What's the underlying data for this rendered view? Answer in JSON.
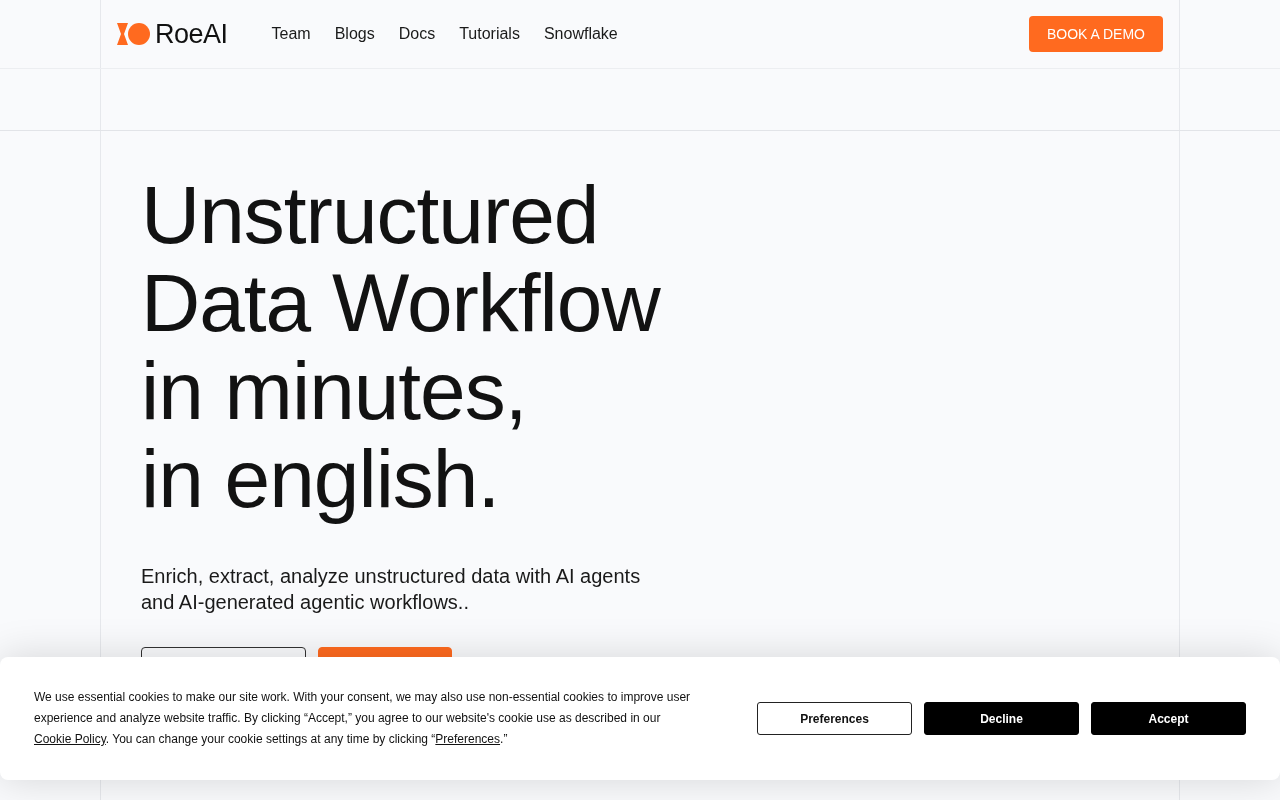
{
  "nav": {
    "logo": "RoeAI",
    "links": [
      {
        "label": "Team"
      },
      {
        "label": "Blogs"
      },
      {
        "label": "Docs"
      },
      {
        "label": "Tutorials"
      },
      {
        "label": "Snowflake"
      }
    ],
    "cta": "BOOK A DEMO"
  },
  "hero": {
    "title_lines": [
      "Unstructured",
      "Data Workflow",
      "in minutes,",
      "in english."
    ],
    "subtitle": "Enrich, extract, analyze unstructured data with AI agents and AI-generated agentic workflows..",
    "buttons": [
      {
        "kind": "outline"
      },
      {
        "kind": "primary"
      }
    ]
  },
  "cookie_banner": {
    "parts": [
      {
        "kind": "text",
        "text": "We use essential cookies to make our site work. With your consent, we may also use non-essential cookies to improve user experience and analyze website traffic. By clicking “Accept,” you agree to our website's cookie use as described in our "
      },
      {
        "kind": "link",
        "text": "Cookie Policy"
      },
      {
        "kind": "text",
        "text": ". You can change your cookie settings at any time by clicking “"
      },
      {
        "kind": "link",
        "text": "Preferences"
      },
      {
        "kind": "text",
        "text": ".”"
      }
    ],
    "buttons": [
      {
        "label": "Preferences",
        "kind": "outline"
      },
      {
        "label": "Decline",
        "kind": "solid"
      },
      {
        "label": "Accept",
        "kind": "solid"
      }
    ]
  }
}
